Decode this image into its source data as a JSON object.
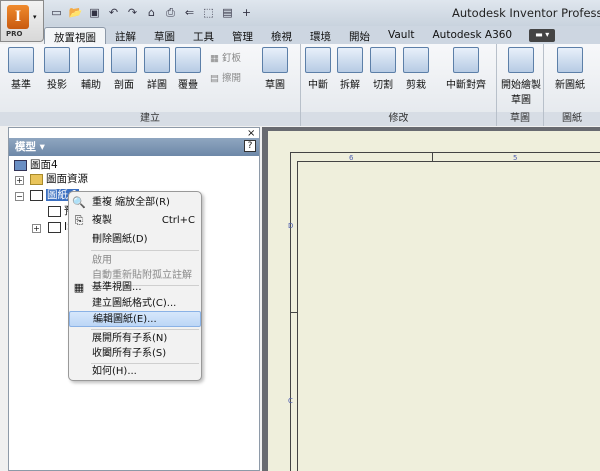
{
  "app": {
    "title": "Autodesk Inventor Professional",
    "logo_letter": "I",
    "edition": "PRO"
  },
  "qat_icons": [
    "new-icon",
    "open-icon",
    "save-icon",
    "undo-icon",
    "redo-icon",
    "home-icon",
    "print-icon",
    "nav-icon",
    "select-icon",
    "appearance-icon",
    "plus-icon"
  ],
  "tabs": [
    "放置視圖",
    "註解",
    "草圖",
    "工具",
    "管理",
    "檢視",
    "環境",
    "開始",
    "Vault",
    "Autodesk A360"
  ],
  "tab_chip": "▬ ▾",
  "ribbon": {
    "create": {
      "label": "建立",
      "buttons": [
        "基準",
        "投影",
        "輔助",
        "剖面",
        "詳圖",
        "覆疊"
      ],
      "small": [
        "釘板",
        "擦開"
      ]
    },
    "sketch_btn": "草圖",
    "modify": {
      "label": "修改",
      "buttons": [
        "中斷",
        "拆解",
        "切割",
        "剪栽"
      ],
      "align": "中斷對齊"
    },
    "sketch_group": {
      "label": "草圖",
      "button_line1": "開始繪製",
      "button_line2": "草圖"
    },
    "sheets": {
      "label": "圖紙",
      "button": "新圖紙"
    }
  },
  "panel": {
    "title": "模型 ▾",
    "help": "?",
    "close": "×"
  },
  "tree": {
    "root": "圖面4",
    "resources": "圖面資源",
    "sheet": "圖紙:1",
    "child1": "預",
    "child2": "IS"
  },
  "context_menu": {
    "items": [
      {
        "label": "重複 縮放全部(R)",
        "icon": "🔍"
      },
      {
        "label": "複製",
        "shortcut": "Ctrl+C",
        "icon": "⎘"
      },
      {
        "label": "刪除圖紙(D)"
      },
      {
        "label": "啟用"
      },
      {
        "label": "自動重新貼附孤立註解"
      },
      {
        "label": "基準視圖...",
        "icon": "▦"
      },
      {
        "label": "建立圖紙格式(C)..."
      },
      {
        "label": "編輯圖紙(E)..."
      },
      {
        "label": "展開所有子系(N)"
      },
      {
        "label": "收闔所有子系(S)"
      },
      {
        "label": "如何(H)..."
      }
    ]
  },
  "canvas": {
    "zone_top_1": "6",
    "zone_top_2": "5",
    "zone_left_1": "D",
    "zone_left_2": "C"
  },
  "colors": {
    "accent": "#3a6fc1",
    "sheet": "#efefdc",
    "canvas": "#686a70"
  }
}
